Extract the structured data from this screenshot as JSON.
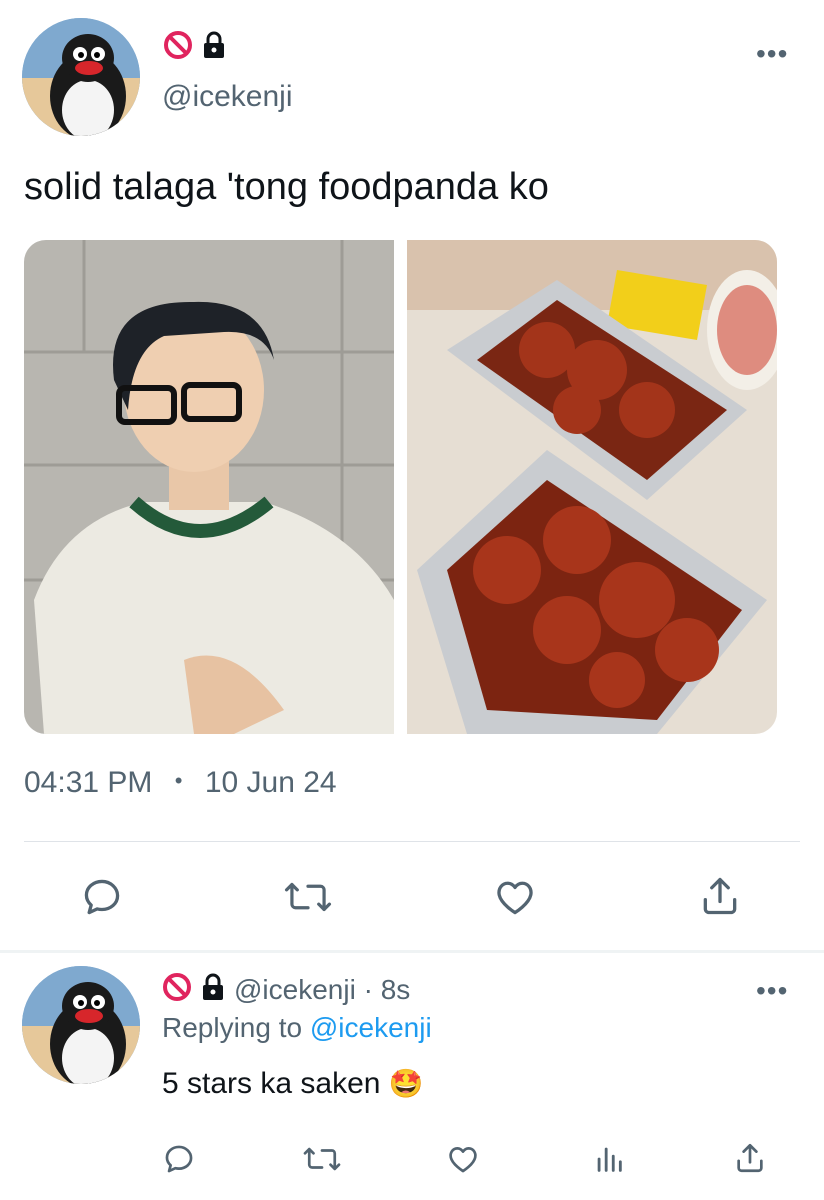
{
  "tweet": {
    "handle": "@icekenji",
    "text": "solid talaga 'tong foodpanda ko",
    "time": "04:31 PM",
    "separator": "•",
    "date": "10 Jun 24",
    "more_label": "•••"
  },
  "reply": {
    "handle": "@icekenji",
    "time_sep": " · ",
    "time": "8s",
    "replying_prefix": "Replying to ",
    "replying_handle": "@icekenji",
    "text": "5 stars ka saken",
    "emoji": "🤩",
    "more_label": "•••"
  },
  "colors": {
    "accent": "#1d9bf0",
    "muted": "#536471",
    "no_entry": "#e0245e"
  },
  "icons": [
    "no-entry-icon",
    "lock-icon",
    "reply-icon",
    "retweet-icon",
    "like-icon",
    "share-icon",
    "analytics-icon"
  ]
}
